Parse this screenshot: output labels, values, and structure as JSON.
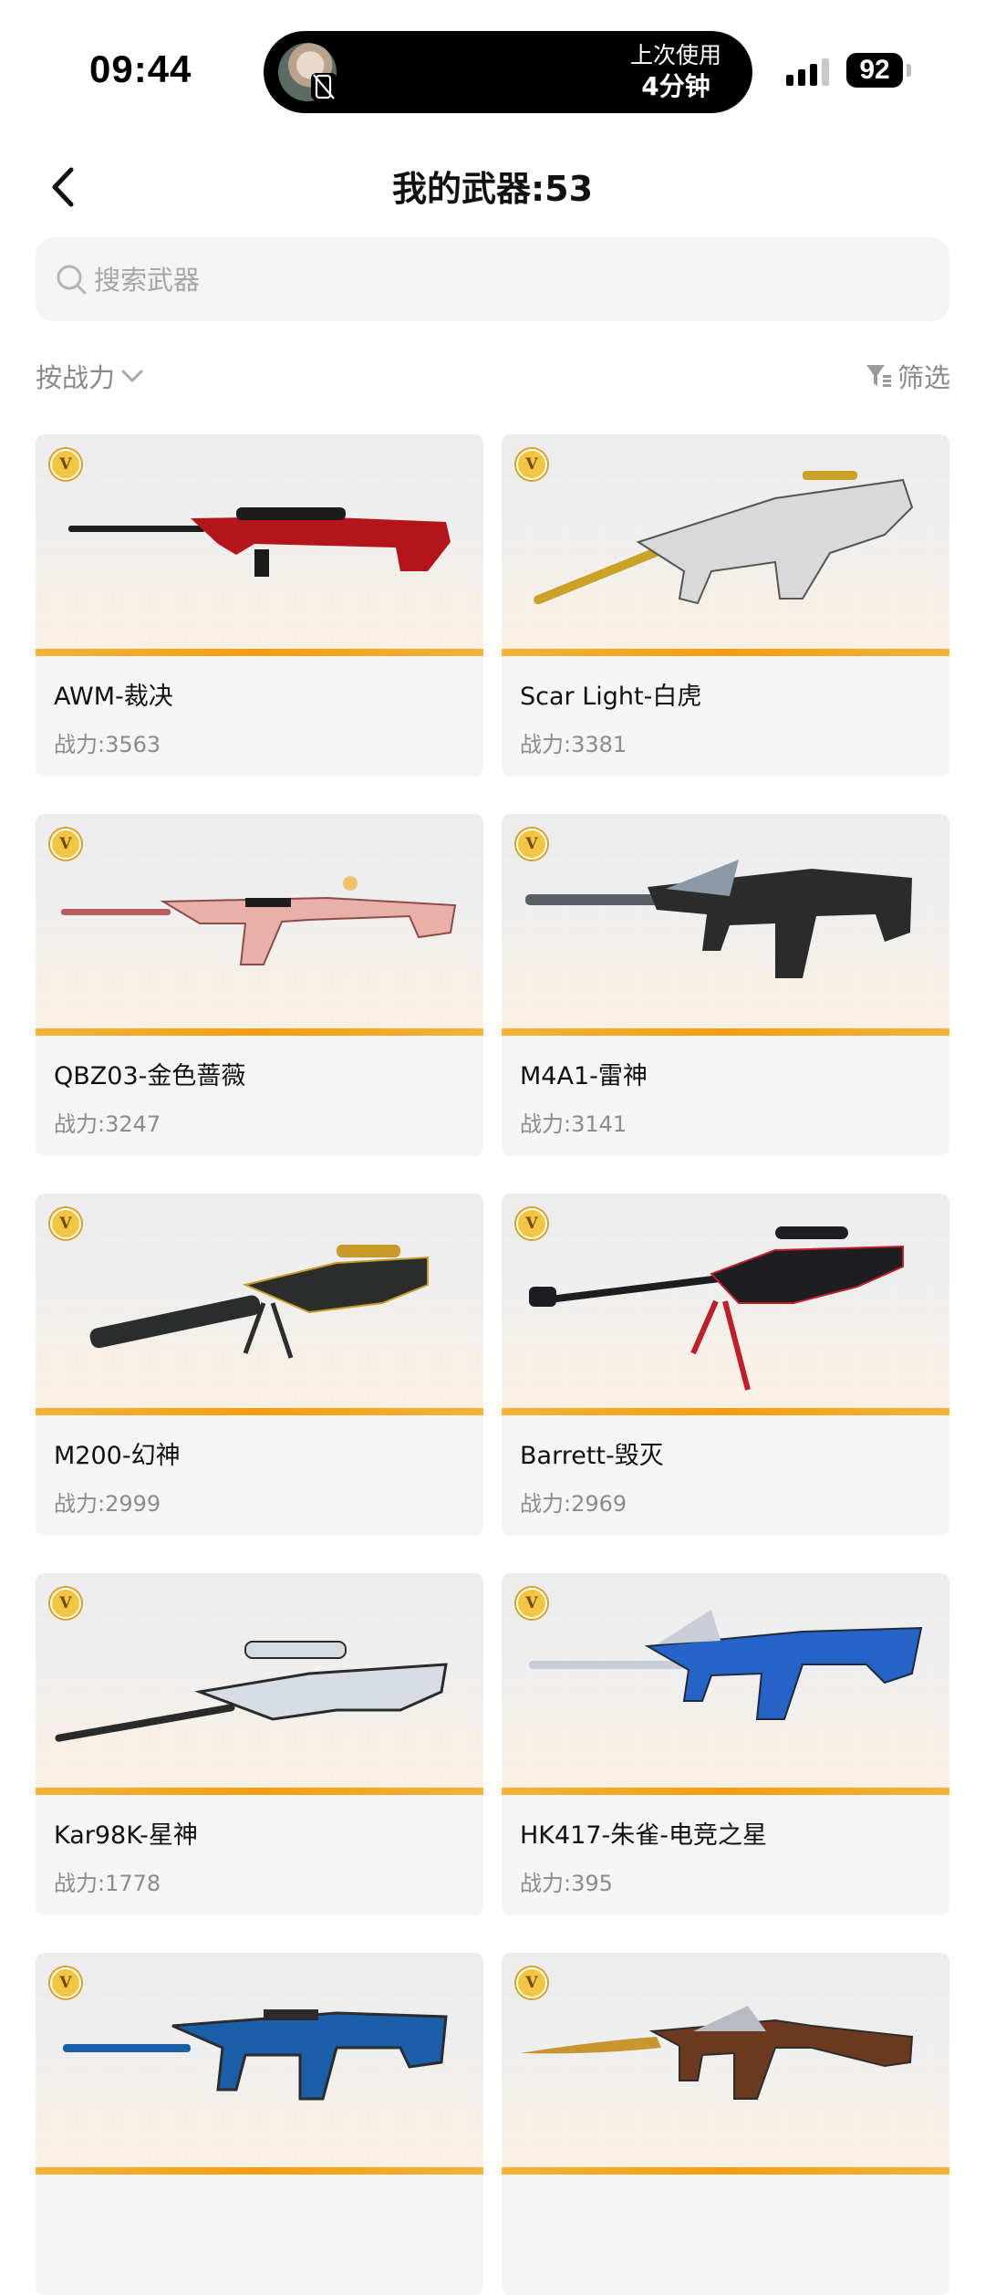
{
  "status_bar": {
    "time": "09:44",
    "island_line1": "上次使用",
    "island_line2": "4分钟",
    "battery": "92"
  },
  "header": {
    "title": "我的武器:53"
  },
  "search": {
    "placeholder": "搜索武器",
    "value": ""
  },
  "controls": {
    "sort_label": "按战力",
    "filter_label": "筛选"
  },
  "weapons": [
    {
      "name": "AWM-裁决",
      "power_label": "战力:3563",
      "badge": "V",
      "colors": [
        "#b3151a",
        "#1c1c1c"
      ]
    },
    {
      "name": "Scar Light-白虎",
      "power_label": "战力:3381",
      "badge": "V",
      "colors": [
        "#d9d9d9",
        "#c9a227"
      ]
    },
    {
      "name": "QBZ03-金色蔷薇",
      "power_label": "战力:3247",
      "badge": "V",
      "colors": [
        "#e8b0a8",
        "#b85c5c"
      ]
    },
    {
      "name": "M4A1-雷神",
      "power_label": "战力:3141",
      "badge": "V",
      "colors": [
        "#2b2b2b",
        "#8b9aa6"
      ]
    },
    {
      "name": "M200-幻神",
      "power_label": "战力:2999",
      "badge": "V",
      "colors": [
        "#2a2d2c",
        "#c79a2a"
      ]
    },
    {
      "name": "Barrett-毁灭",
      "power_label": "战力:2969",
      "badge": "V",
      "colors": [
        "#1e1e22",
        "#c21d2b"
      ]
    },
    {
      "name": "Kar98K-星神",
      "power_label": "战力:1778",
      "badge": "V",
      "colors": [
        "#2a2a2a",
        "#d8dde3"
      ]
    },
    {
      "name": "HK417-朱雀-电竞之星",
      "power_label": "战力:395",
      "badge": "V",
      "colors": [
        "#2563c9",
        "#c9ced6"
      ]
    },
    {
      "name": "",
      "power_label": "",
      "badge": "V",
      "colors": [
        "#1b5fa8",
        "#2c2c30"
      ]
    },
    {
      "name": "",
      "power_label": "",
      "badge": "V",
      "colors": [
        "#6b3a1e",
        "#c8962e"
      ]
    }
  ]
}
